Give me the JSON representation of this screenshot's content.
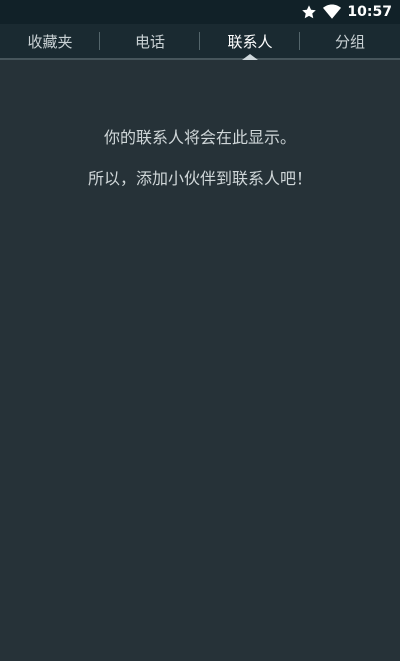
{
  "status_bar": {
    "time": "10:57",
    "icons": [
      "star-icon",
      "wifi-icon"
    ]
  },
  "tabs": [
    {
      "label": "收藏夹",
      "active": false
    },
    {
      "label": "电话",
      "active": false
    },
    {
      "label": "联系人",
      "active": true
    },
    {
      "label": "分组",
      "active": false
    }
  ],
  "empty_state": {
    "line1": "你的联系人将会在此显示。",
    "line2": "所以，添加小伙伴到联系人吧！"
  },
  "colors": {
    "background": "#263238",
    "status_bar": "#112128",
    "tab_bar": "#1a2a31"
  }
}
